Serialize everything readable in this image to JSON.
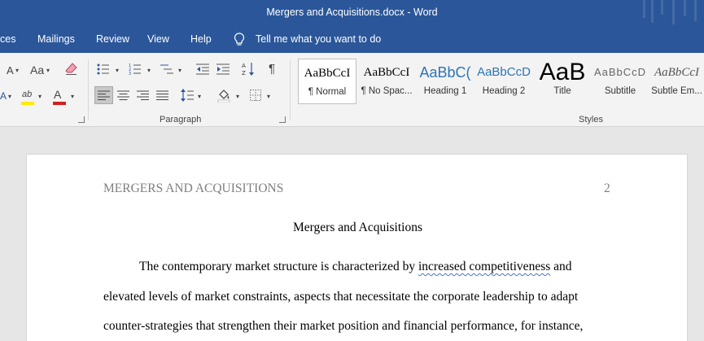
{
  "window": {
    "title": "Mergers and Acquisitions.docx  -  Word"
  },
  "menu": {
    "tabs": [
      "ces",
      "Mailings",
      "Review",
      "View",
      "Help"
    ],
    "tell_me": "Tell me what you want to do"
  },
  "ribbon": {
    "font_group": {
      "case_glyph": "Aa",
      "grow_glyph": "A",
      "highlight_glyph": "ab",
      "font_color_glyph": "A"
    },
    "paragraph_label": "Paragraph",
    "pilcrow": "¶",
    "styles_label": "Styles",
    "styles": [
      {
        "sample": "AaBbCcI",
        "name": "¶ Normal"
      },
      {
        "sample": "AaBbCcI",
        "name": "¶ No Spac..."
      },
      {
        "sample": "AaBbC(",
        "name": "Heading 1"
      },
      {
        "sample": "AaBbCcD",
        "name": "Heading 2"
      },
      {
        "sample": "AaB",
        "name": "Title"
      },
      {
        "sample": "AaBbCcD",
        "name": "Subtitle"
      },
      {
        "sample": "AaBbCcI",
        "name": "Subtle Em..."
      }
    ],
    "colors": {
      "highlight": "#ffeb00",
      "font_color": "#d21f1f",
      "accent": "#2b579a"
    }
  },
  "document": {
    "header_title": "MERGERS AND ACQUISITIONS",
    "page_number": "2",
    "title": "Mergers and Acquisitions",
    "line1_before": "The contemporary market structure is characterized by ",
    "line1_flagged": "increased  competitiveness",
    "line1_after": " and",
    "line2": "elevated levels of market constraints, aspects that necessitate the corporate leadership to adapt",
    "line3": "counter-strategies that strengthen their market position and financial performance, for instance,"
  }
}
